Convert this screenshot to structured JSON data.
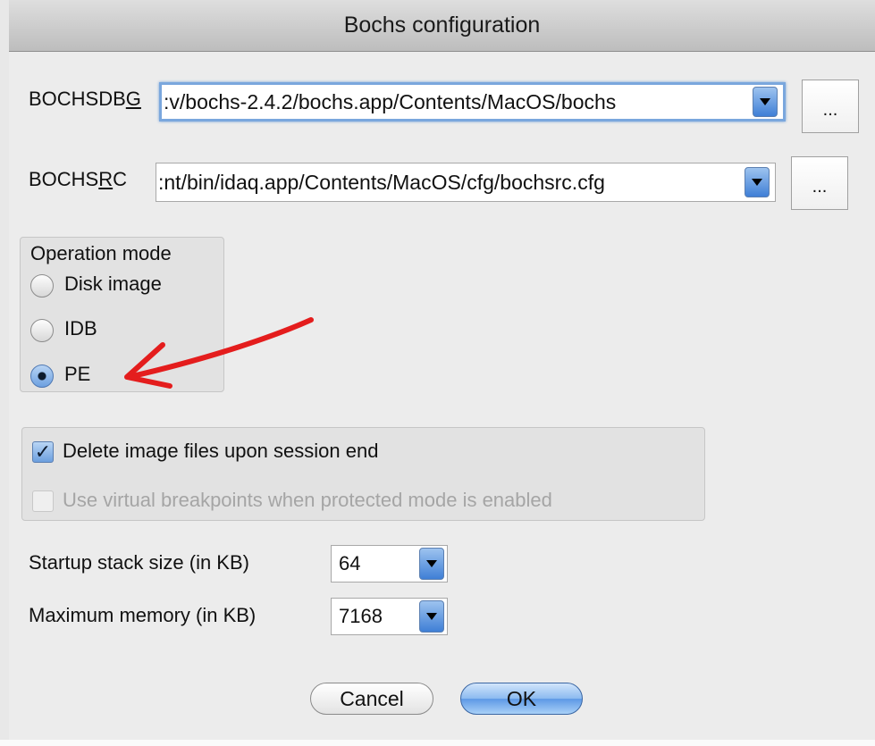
{
  "window": {
    "title": "Bochs configuration"
  },
  "bochsdbg": {
    "label_pre": "BOCHSDB",
    "label_mnemonic": "G",
    "value": ":v/bochs-2.4.2/bochs.app/Contents/MacOS/bochs",
    "browse_label": "..."
  },
  "bochsrc": {
    "label_pre": "BOCHS",
    "label_mnemonic": "R",
    "label_post": "C",
    "value": ":nt/bin/idaq.app/Contents/MacOS/cfg/bochsrc.cfg",
    "browse_label": "..."
  },
  "operation_mode": {
    "title": "Operation mode",
    "options": [
      {
        "label": "Disk image",
        "selected": false
      },
      {
        "label": "IDB",
        "selected": false
      },
      {
        "label": "PE",
        "selected": true
      }
    ]
  },
  "options": {
    "delete_images": {
      "label": "Delete image files upon session end",
      "checked": true,
      "enabled": true
    },
    "virtual_bp": {
      "label": "Use virtual breakpoints when protected mode is enabled",
      "checked": false,
      "enabled": false
    }
  },
  "stack_size": {
    "label": "Startup stack size (in KB)",
    "value": "64"
  },
  "max_memory": {
    "label": "Maximum memory (in KB)",
    "value": "7168"
  },
  "buttons": {
    "cancel": "Cancel",
    "ok": "OK"
  },
  "colors": {
    "annotation_arrow": "#e41d1d",
    "focus_ring": "#7aa7dd"
  }
}
